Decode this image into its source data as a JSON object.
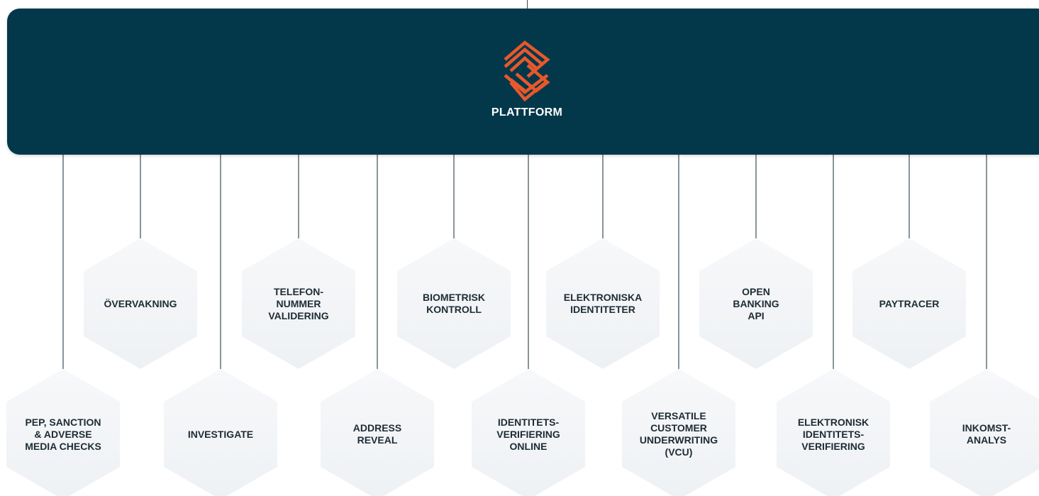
{
  "platform": {
    "title": "PLATTFORM",
    "bar_color": "#03384b",
    "logo_color": "#e8582b",
    "logo_icon": "layered-stripes-logo"
  },
  "modules": [
    {
      "id": "pep",
      "label": "PEP, SANCTION\n& ADVERSE\nMEDIA CHECKS"
    },
    {
      "id": "overvakning",
      "label": "ÖVERVAKNING"
    },
    {
      "id": "investigate",
      "label": "INVESTIGATE"
    },
    {
      "id": "telefonnummer",
      "label": "TELEFON-\nNUMMER\nVALIDERING"
    },
    {
      "id": "address-reveal",
      "label": "ADDRESS\nREVEAL"
    },
    {
      "id": "biometrisk",
      "label": "BIOMETRISK\nKONTROLL"
    },
    {
      "id": "identitetsverifiering",
      "label": "IDENTITETS-\nVERIFIERING\nONLINE"
    },
    {
      "id": "elektroniska",
      "label": "ELEKTRONISKA\nIDENTITETER"
    },
    {
      "id": "vcu",
      "label": "VERSATILE\nCUSTOMER\nUNDERWRITING\n(VCU)"
    },
    {
      "id": "open-banking",
      "label": "OPEN\nBANKING\nAPI"
    },
    {
      "id": "elektronisk-id",
      "label": "ELEKTRONISK\nIDENTITETS-\nVERIFIERING"
    },
    {
      "id": "paytracer",
      "label": "PAYTRACER"
    },
    {
      "id": "inkomstanalys",
      "label": "INKOMST-\nANALYS"
    }
  ]
}
